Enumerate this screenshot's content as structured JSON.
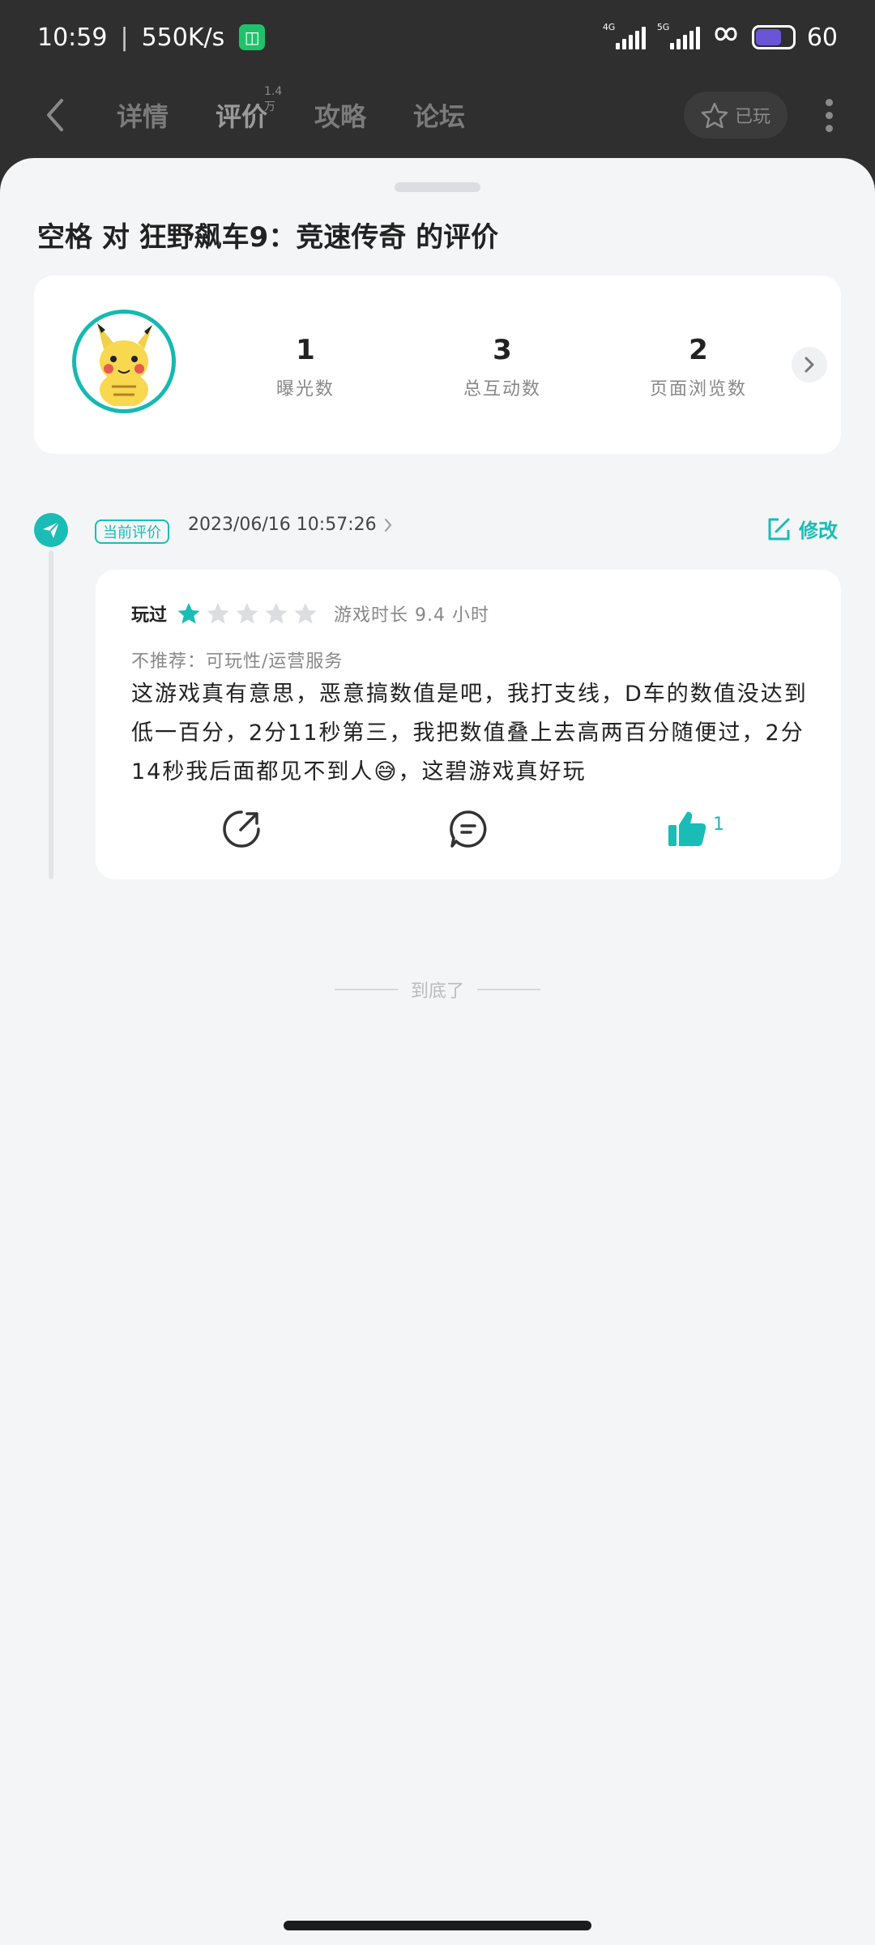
{
  "status_bar": {
    "time": "10:59",
    "speed": "550K/s",
    "net1": "4G",
    "net2": "5G",
    "battery": "60"
  },
  "nav": {
    "tabs": [
      {
        "label": "详情"
      },
      {
        "label": "评价",
        "count": "1.4万"
      },
      {
        "label": "攻略"
      },
      {
        "label": "论坛"
      }
    ],
    "played_label": "已玩"
  },
  "sheet": {
    "title": "空格 对 狂野飙车9：竞速传奇 的评价"
  },
  "stats": [
    {
      "value": "1",
      "label": "曝光数"
    },
    {
      "value": "3",
      "label": "总互动数"
    },
    {
      "value": "2",
      "label": "页面浏览数"
    }
  ],
  "review": {
    "badge": "当前评价",
    "date": "2023/06/16 10:57:26",
    "edit_label": "修改",
    "played_tag": "玩过",
    "rating": 1,
    "rating_max": 5,
    "playtime": "游戏时长 9.4 小时",
    "not_recommend": "不推荐：可玩性/运营服务",
    "content": "这游戏真有意思，恶意搞数值是吧，我打支线，D车的数值没达到低一百分，2分11秒第三，我把数值叠上去高两百分随便过，2分14秒我后面都见不到人😅，这碧游戏真好玩",
    "like_count": "1"
  },
  "footer": {
    "end_text": "到底了"
  },
  "colors": {
    "accent": "#19bdb5",
    "dark_header": "#2f2f2f",
    "sheet_bg": "#f4f5f7"
  }
}
